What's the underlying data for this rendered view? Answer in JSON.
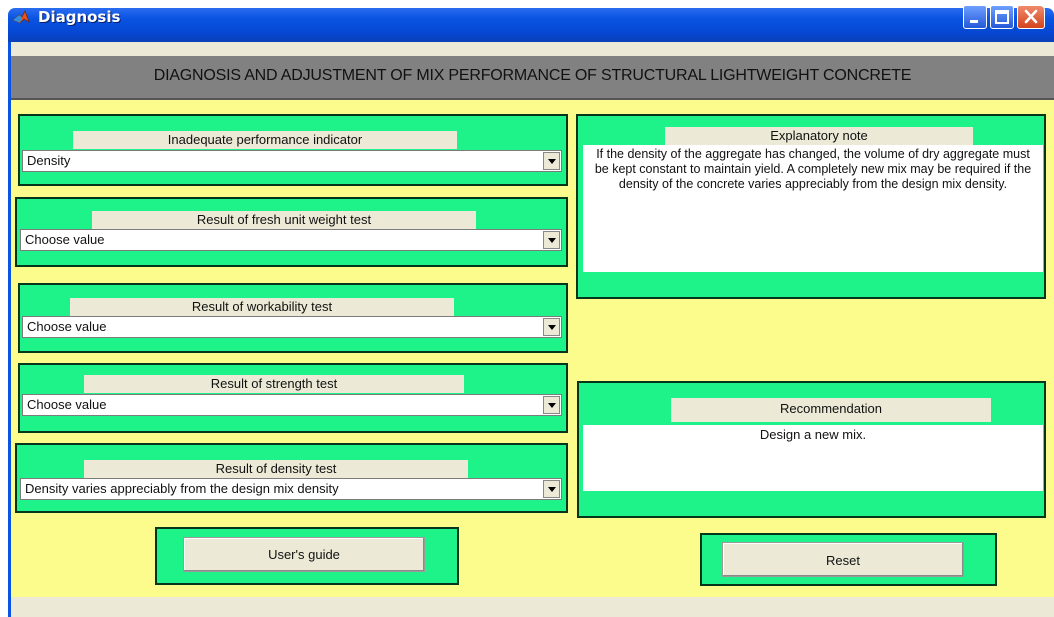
{
  "window": {
    "title": "Diagnosis"
  },
  "header": {
    "title": "DIAGNOSIS AND ADJUSTMENT OF MIX PERFORMANCE OF STRUCTURAL LIGHTWEIGHT CONCRETE"
  },
  "panels": {
    "performance_indicator": {
      "label": "Inadequate performance indicator",
      "value": "Density"
    },
    "fresh_unit_weight": {
      "label": "Result of fresh unit weight test",
      "value": "Choose value"
    },
    "workability": {
      "label": "Result of workability test",
      "value": "Choose value"
    },
    "strength": {
      "label": "Result of strength test",
      "value": "Choose value"
    },
    "density": {
      "label": "Result of density test",
      "value": "Density varies appreciably from the design mix density"
    }
  },
  "explanatory_note": {
    "label": "Explanatory note",
    "text": "If the density of the aggregate has changed, the volume of dry aggregate must be kept constant to maintain yield. A completely new mix may be required if the density of the concrete varies appreciably from the design mix density."
  },
  "recommendation": {
    "label": "Recommendation",
    "text": "Design a new mix."
  },
  "buttons": {
    "users_guide": "User's guide",
    "reset": "Reset"
  },
  "colors": {
    "panel_green": "#1ef389",
    "background_yellow": "#fcfc8c",
    "header_gray": "#818181",
    "titlebar_blue": "#0a54e3"
  },
  "icons": {
    "app": "matlab-icon",
    "minimize": "minimize-icon",
    "maximize": "maximize-icon",
    "close": "close-icon",
    "dropdown": "chevron-down-icon"
  }
}
